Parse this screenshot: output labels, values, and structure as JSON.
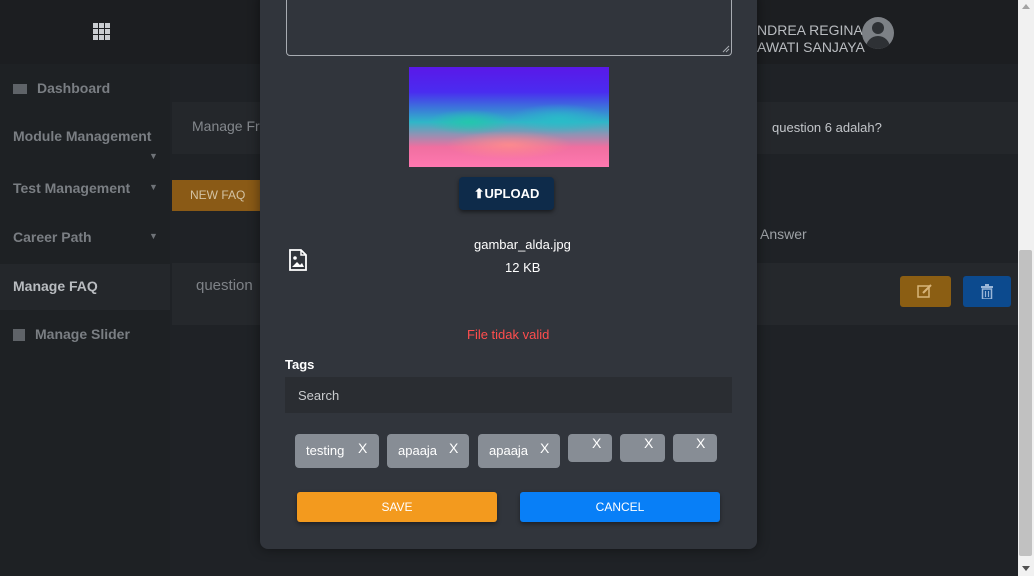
{
  "topbar": {
    "user_name_line1": "NDREA REGINA",
    "user_name_line2": "AWATI SANJAYA"
  },
  "sidebar": {
    "items": [
      {
        "label": "Dashboard"
      },
      {
        "label": "Module Management"
      },
      {
        "label": "Test Management"
      },
      {
        "label": "Career Path"
      },
      {
        "label": "Manage FAQ"
      },
      {
        "label": "Manage Slider"
      }
    ]
  },
  "main": {
    "header_label": "Manage Fr",
    "question_title": "question 6 adalah?",
    "new_faq_label": "NEW FAQ",
    "answer_column": "Answer",
    "row_question": "question"
  },
  "modal": {
    "upload_label": "UPLOAD",
    "file_name": "gambar_alda.jpg",
    "file_size": "12 KB",
    "error": "File tidak valid",
    "tags_label": "Tags",
    "search_placeholder": "Search",
    "tags": [
      {
        "label": "testing",
        "remove": "X"
      },
      {
        "label": "apaaja",
        "remove": "X"
      },
      {
        "label": "apaaja",
        "remove": "X"
      },
      {
        "label": "",
        "remove": "X"
      },
      {
        "label": "",
        "remove": "X"
      },
      {
        "label": "",
        "remove": "X"
      }
    ],
    "save_label": "SAVE",
    "cancel_label": "CANCEL"
  },
  "colors": {
    "save": "#f39a1e",
    "cancel": "#087ff7",
    "error": "#ff4d4d",
    "upload": "#0e2b4a"
  }
}
